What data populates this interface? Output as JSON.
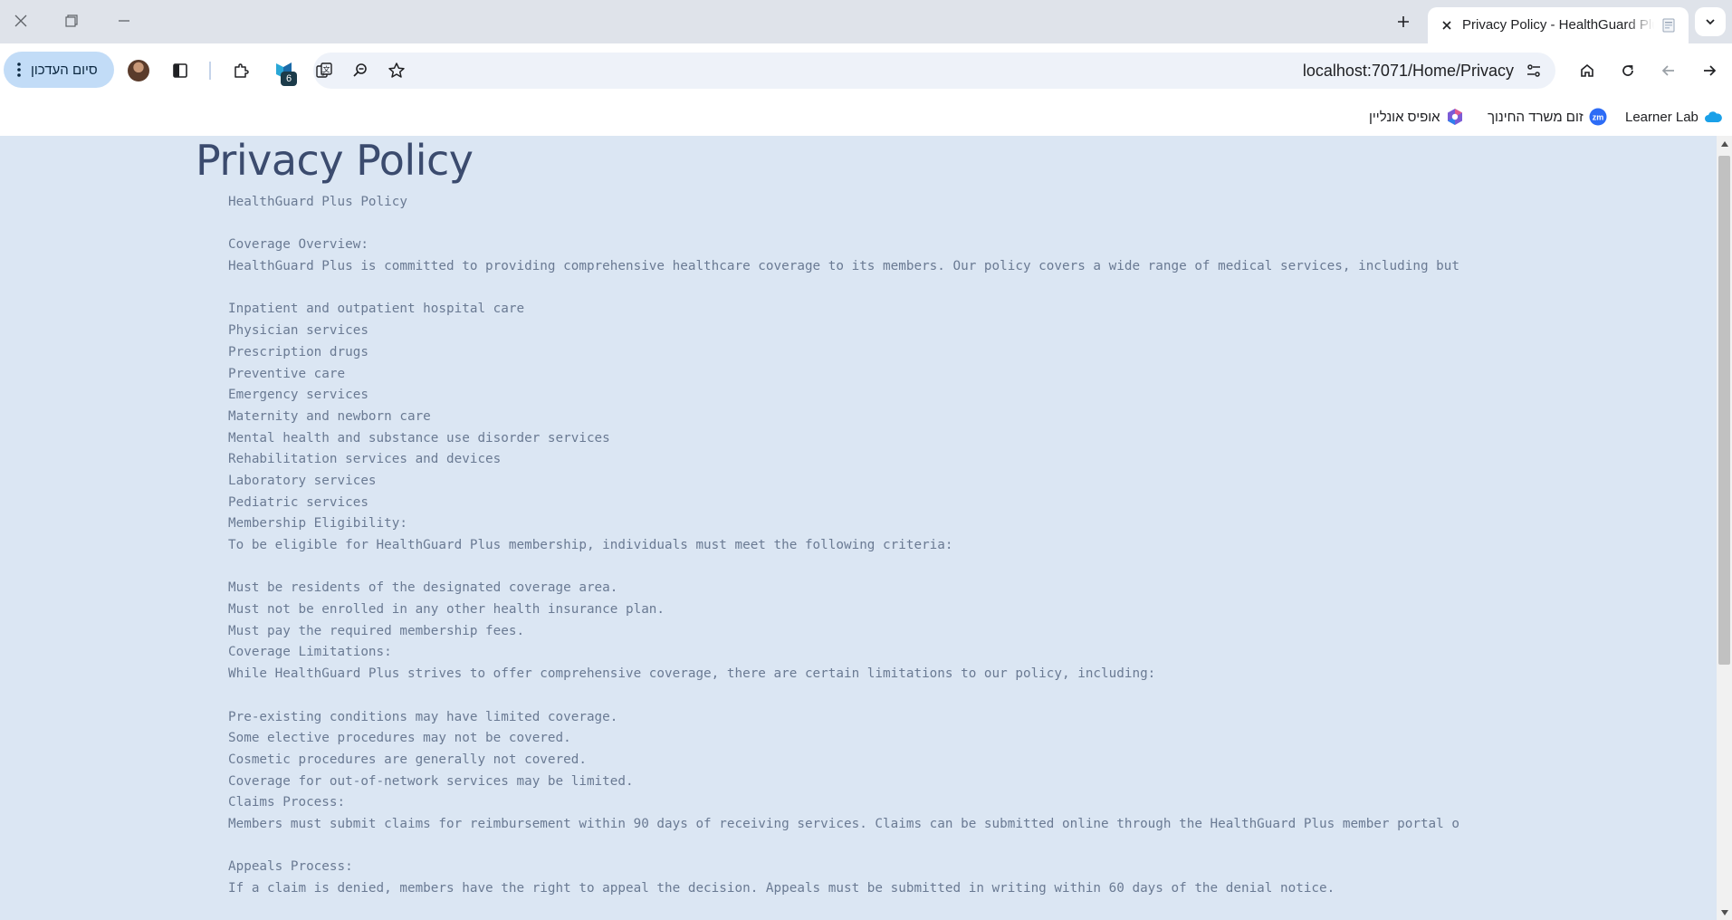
{
  "browser": {
    "tab": {
      "title": "Privacy Policy - HealthGuard Plus"
    },
    "url": "localhost:7071/Home/Privacy",
    "update_button": "סיום העדכון",
    "extension_badge": "6"
  },
  "bookmarks": [
    {
      "label": "Learner Lab",
      "icon": "cloud-icon"
    },
    {
      "label": "זום משרד החינוך",
      "icon": "zoom-icon"
    },
    {
      "label": "אופיס אונליין",
      "icon": "office-icon"
    }
  ],
  "page": {
    "title": "Privacy Policy",
    "policy_lines": [
      "HealthGuard Plus Policy",
      "",
      "Coverage Overview:",
      "HealthGuard Plus is committed to providing comprehensive healthcare coverage to its members. Our policy covers a wide range of medical services, including but",
      "",
      "Inpatient and outpatient hospital care",
      "Physician services",
      "Prescription drugs",
      "Preventive care",
      "Emergency services",
      "Maternity and newborn care",
      "Mental health and substance use disorder services",
      "Rehabilitation services and devices",
      "Laboratory services",
      "Pediatric services",
      "Membership Eligibility:",
      "To be eligible for HealthGuard Plus membership, individuals must meet the following criteria:",
      "",
      "Must be residents of the designated coverage area.",
      "Must not be enrolled in any other health insurance plan.",
      "Must pay the required membership fees.",
      "Coverage Limitations:",
      "While HealthGuard Plus strives to offer comprehensive coverage, there are certain limitations to our policy, including:",
      "",
      "Pre-existing conditions may have limited coverage.",
      "Some elective procedures may not be covered.",
      "Cosmetic procedures are generally not covered.",
      "Coverage for out-of-network services may be limited.",
      "Claims Process:",
      "Members must submit claims for reimbursement within 90 days of receiving services. Claims can be submitted online through the HealthGuard Plus member portal o",
      "",
      "Appeals Process:",
      "If a claim is denied, members have the right to appeal the decision. Appeals must be submitted in writing within 60 days of the denial notice."
    ]
  }
}
